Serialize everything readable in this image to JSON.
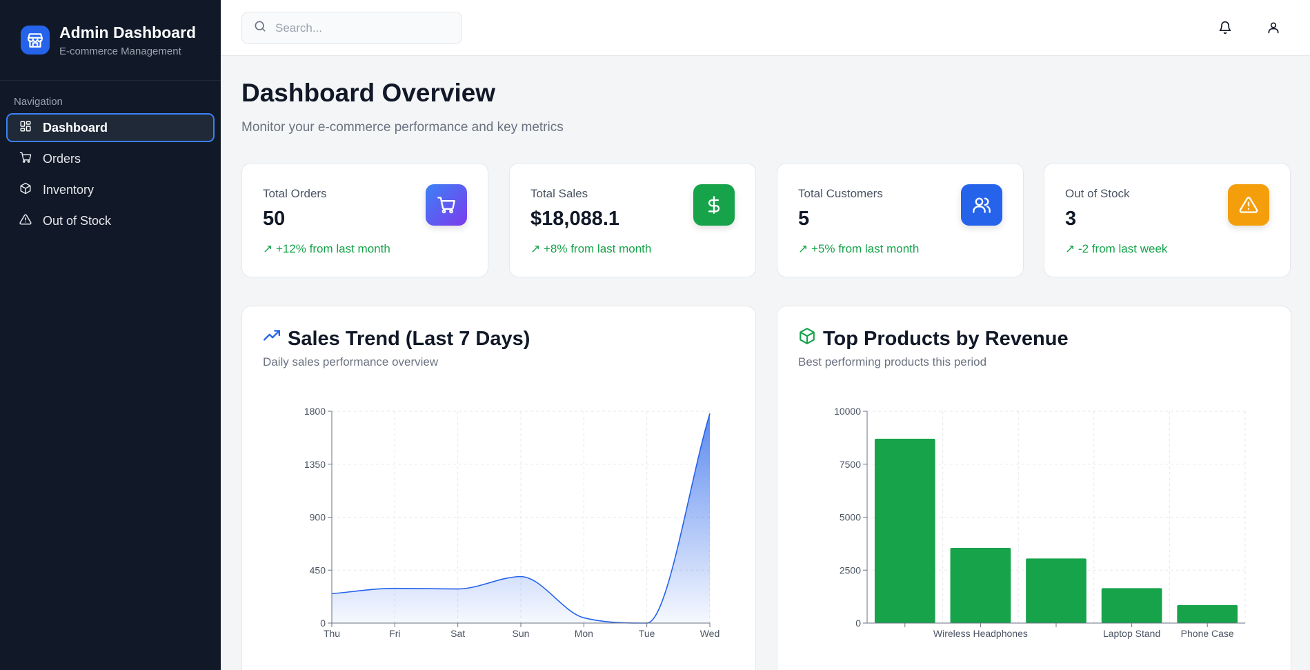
{
  "sidebar": {
    "brand_title": "Admin Dashboard",
    "brand_subtitle": "E-commerce Management",
    "nav_label": "Navigation",
    "items": [
      {
        "label": "Dashboard",
        "icon": "grid-icon",
        "active": true
      },
      {
        "label": "Orders",
        "icon": "cart-icon"
      },
      {
        "label": "Inventory",
        "icon": "box-icon"
      },
      {
        "label": "Out of Stock",
        "icon": "alert-triangle-icon"
      }
    ]
  },
  "topbar": {
    "search_placeholder": "Search...",
    "icons": [
      "bell-icon",
      "user-icon"
    ]
  },
  "page": {
    "title": "Dashboard Overview",
    "subtitle": "Monitor your e-commerce performance and key metrics"
  },
  "colors": {
    "accent": "#2563eb",
    "sidebar": "#111827",
    "trend_up": "#16a34a",
    "bar": "#16a34a"
  },
  "cards": [
    {
      "label": "Total Orders",
      "value": "50",
      "trend": "↗ +12% from last month",
      "icon": "cart-icon",
      "color": "#4f46e5"
    },
    {
      "label": "Total Sales",
      "value": "$18,088.1",
      "trend": "↗ +8% from last month",
      "icon": "dollar-icon",
      "color": "#16a34a"
    },
    {
      "label": "Total Customers",
      "value": "5",
      "trend": "↗ +5% from last month",
      "icon": "users-icon",
      "color": "#2563eb"
    },
    {
      "label": "Out of Stock",
      "value": "3",
      "trend": "↗ -2 from last week",
      "icon": "alert-triangle-icon",
      "color": "#f59e0b"
    }
  ],
  "panels": {
    "sales": {
      "title": "Sales Trend (Last 7 Days)",
      "subtitle": "Daily sales performance overview",
      "icon": "trending-up-icon"
    },
    "products": {
      "title": "Top Products by Revenue",
      "subtitle": "Best performing products this period",
      "icon": "box-icon"
    }
  },
  "chart_data": [
    {
      "type": "area",
      "title": "Sales Trend (Last 7 Days)",
      "categories": [
        "Thu",
        "Fri",
        "Sat",
        "Sun",
        "Mon",
        "Tue",
        "Wed"
      ],
      "values": [
        250,
        295,
        290,
        395,
        45,
        0,
        1780
      ],
      "ylim": [
        0,
        1800
      ],
      "yticks": [
        0,
        450,
        900,
        1350,
        1800
      ],
      "grid": true,
      "color": "#2563eb"
    },
    {
      "type": "bar",
      "title": "Top Products by Revenue",
      "categories": [
        "",
        "Wireless Headphones",
        "",
        "Laptop Stand",
        "Phone Case"
      ],
      "values": [
        8700,
        3550,
        3050,
        1650,
        850
      ],
      "ylim": [
        0,
        10000
      ],
      "yticks": [
        0,
        2500,
        5000,
        7500,
        10000
      ],
      "grid": true,
      "color": "#16a34a"
    }
  ]
}
